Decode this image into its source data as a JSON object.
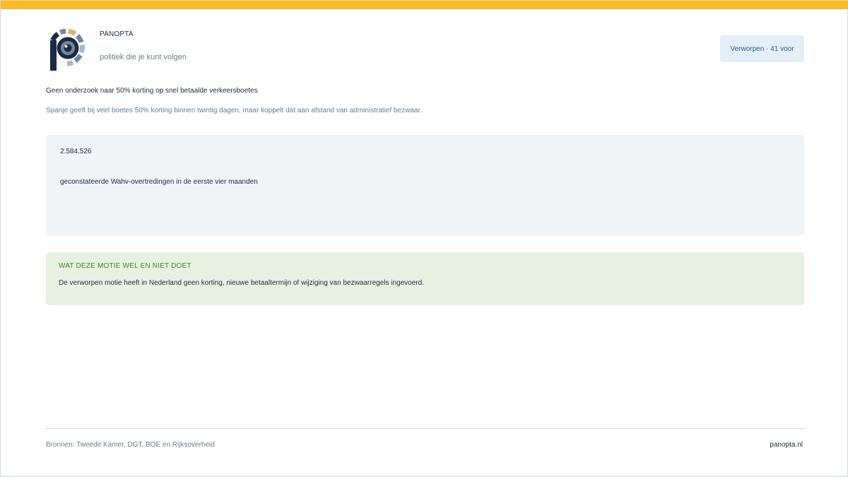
{
  "brand": {
    "name": "PANOPTA",
    "tagline": "politiek die je kunt volgen",
    "logo_icon": "panopta-eye-logo-icon",
    "colors": {
      "navy": "#1c2a44",
      "accent": "#d9b36c",
      "steel": "#6f86a6",
      "light": "#a6b6cc"
    }
  },
  "status_badge": {
    "label": "Verworpen · 41 voor"
  },
  "headline": "Geen onderzoek naar 50% korting op snel betaalde verkeersboetes",
  "subline": "Spanje geeft bij veel boetes 50% korting binnen twintig dagen, maar koppelt dat aan afstand van administratief bezwaar.",
  "stat": {
    "number": "2.584.526",
    "label": "geconstateerde Wahv-overtredingen in de eerste vier maanden"
  },
  "note": {
    "heading": "WAT DEZE MOTIE WEL EN NIET DOET",
    "text": "De verworpen motie heeft in Nederland geen korting, nieuwe betaaltermijn of wijziging van bezwaarregels ingevoerd."
  },
  "footer": {
    "sources": "Bronnen: Tweede Kamer, DGT, BOE en Rijksoverheid",
    "site": "panopta.nl"
  },
  "theme": {
    "top_bar": "#fbba1d",
    "badge_bg": "#e4eef6",
    "stat_bg": "#f0f4f7",
    "note_bg": "#e6f1e2",
    "note_heading": "#3f8a1c"
  }
}
